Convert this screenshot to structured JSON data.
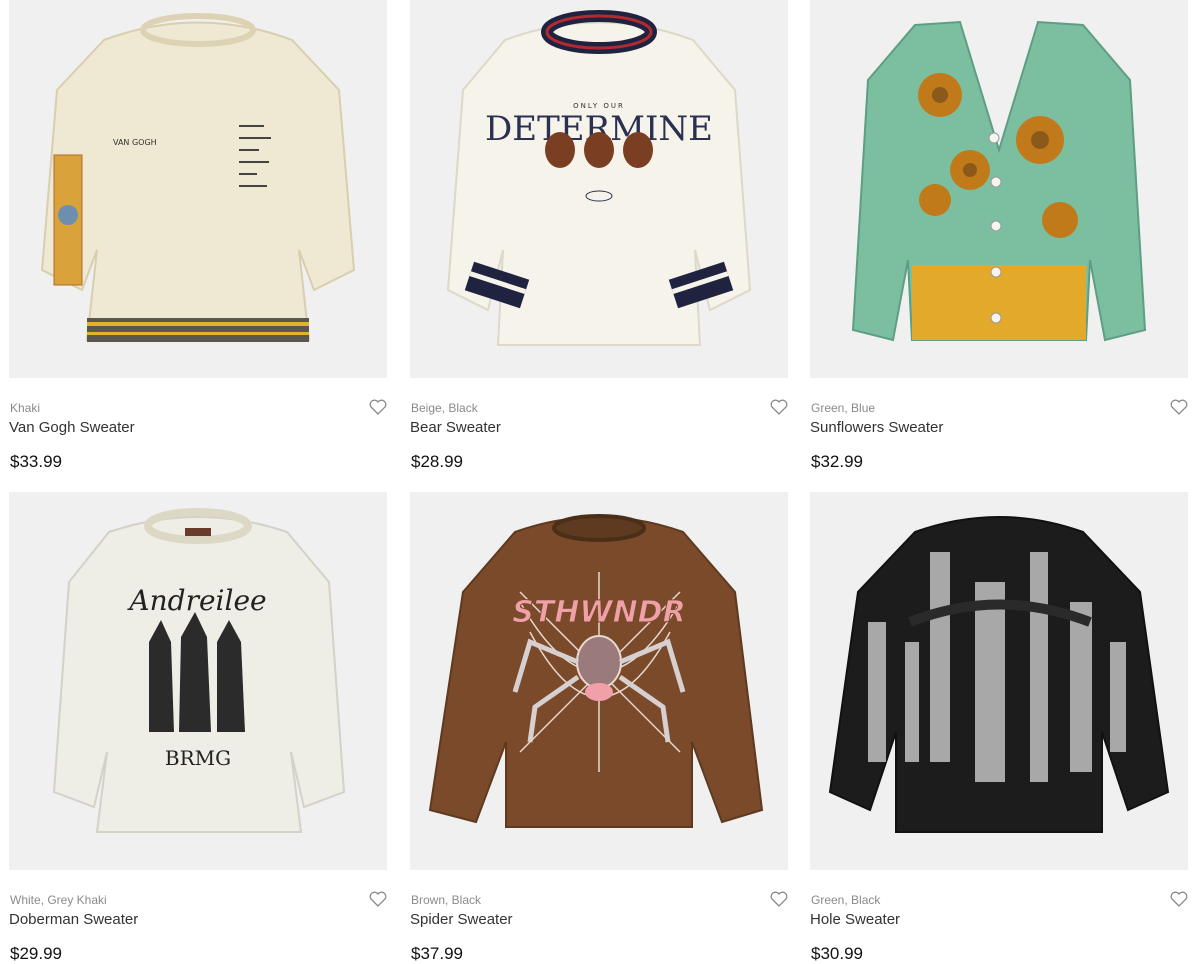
{
  "products": [
    {
      "colors": "Khaki",
      "name": "Van Gogh Sweater",
      "price": "$33.99",
      "sweater_color": "#efe8d2",
      "accent": "#5a5650",
      "image_text": [
        "VAN GOGH"
      ]
    },
    {
      "colors": "Beige, Black",
      "name": "Bear Sweater",
      "price": "$28.99",
      "sweater_color": "#f6f3ea",
      "accent": "#1f2340",
      "image_text": [
        "ONLY OUR",
        "DETERMINE"
      ]
    },
    {
      "colors": "Green, Blue",
      "name": "Sunflowers Sweater",
      "price": "$32.99",
      "sweater_color": "#7cbfa0",
      "accent": "#e2a92a",
      "image_text": []
    },
    {
      "colors": "White, Grey Khaki",
      "name": "Doberman Sweater",
      "price": "$29.99",
      "sweater_color": "#eeeee6",
      "accent": "#2b2b2b",
      "image_text": [
        "Andreilee",
        "BRMG"
      ]
    },
    {
      "colors": "Brown, Black",
      "name": "Spider Sweater",
      "price": "$37.99",
      "sweater_color": "#7a4a2a",
      "accent": "#f0a0a8",
      "image_text": [
        "STHWNDR"
      ]
    },
    {
      "colors": "Green, Black",
      "name": "Hole Sweater",
      "price": "$30.99",
      "sweater_color": "#1c1c1c",
      "accent": "#a8a8a8",
      "image_text": []
    }
  ],
  "icons": {
    "favorite": "heart-outline-icon"
  }
}
